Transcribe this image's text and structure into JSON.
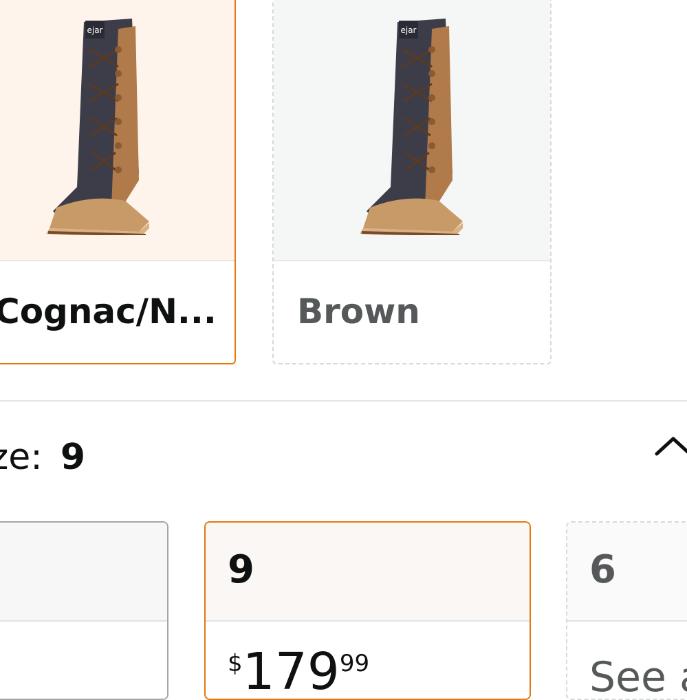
{
  "color_options": [
    {
      "label": "Cognac/N...",
      "state": "selected"
    },
    {
      "label": "Brown",
      "state": "unavailable"
    }
  ],
  "size_selector": {
    "label": "ze:",
    "value": "9",
    "toggle_icon": "chevron-up-icon"
  },
  "size_options": [
    {
      "size": "",
      "state": "normal"
    },
    {
      "size": "9",
      "state": "selected",
      "price": {
        "currency": "$",
        "whole": "179",
        "fraction": "99"
      }
    },
    {
      "size": "6",
      "state": "unavailable",
      "note": "See a"
    }
  ],
  "colors": {
    "selected_border": "#e47911",
    "selected_bg": "#fff4ec",
    "unavailable_border": "#d5d9d9",
    "text_primary": "#0f1111",
    "text_muted": "#565959"
  }
}
